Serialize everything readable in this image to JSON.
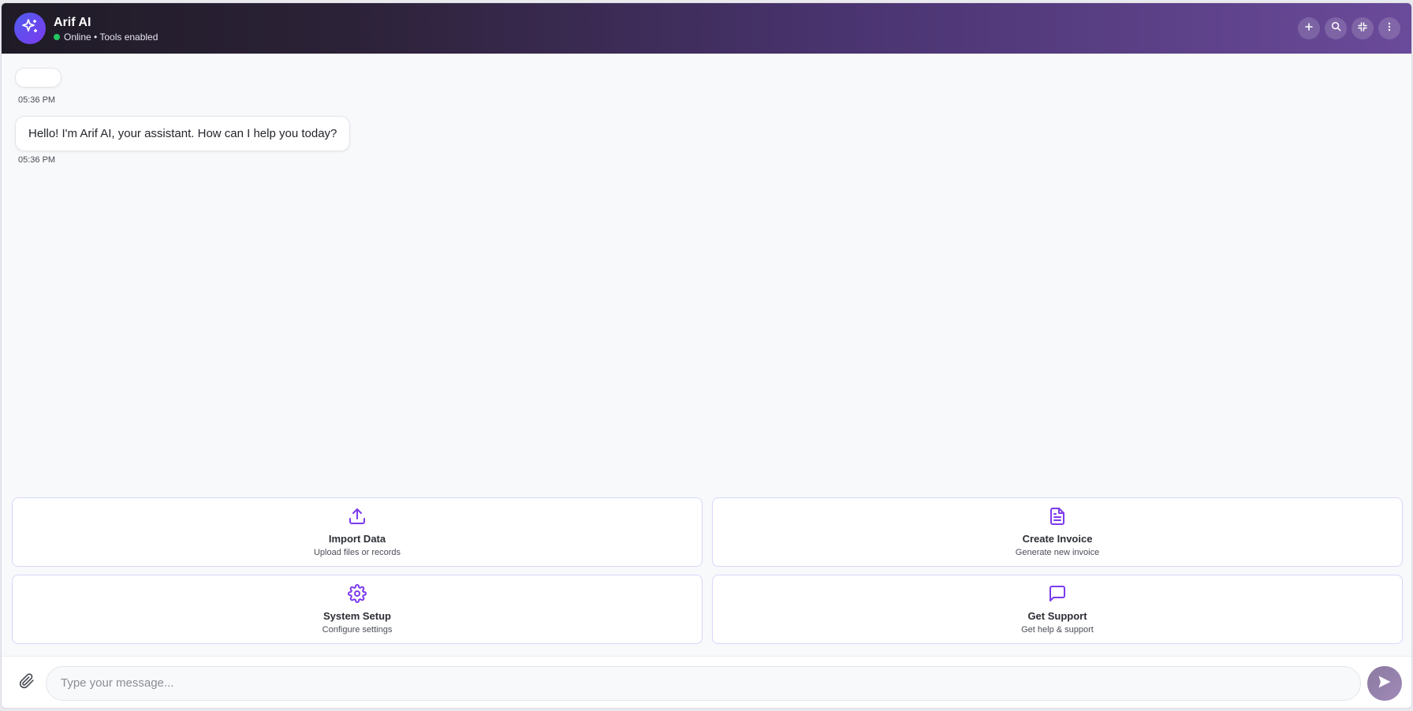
{
  "header": {
    "title": "Arif AI",
    "status": "Online • Tools enabled",
    "actions": [
      {
        "name": "new-chat",
        "icon": "plus-icon"
      },
      {
        "name": "search",
        "icon": "search-icon"
      },
      {
        "name": "minimize",
        "icon": "collapse-icon"
      },
      {
        "name": "menu",
        "icon": "more-vertical-icon"
      }
    ]
  },
  "messages": [
    {
      "text": "",
      "time": "05:36 PM"
    },
    {
      "text": "Hello! I'm Arif AI, your assistant. How can I help you today?",
      "time": "05:36 PM"
    }
  ],
  "quick_actions": [
    {
      "title": "Import Data",
      "subtitle": "Upload files or records",
      "icon": "upload-icon"
    },
    {
      "title": "Create Invoice",
      "subtitle": "Generate new invoice",
      "icon": "file-text-icon"
    },
    {
      "title": "System Setup",
      "subtitle": "Configure settings",
      "icon": "gear-icon"
    },
    {
      "title": "Get Support",
      "subtitle": "Get help & support",
      "icon": "message-square-icon"
    }
  ],
  "composer": {
    "placeholder": "Type your message..."
  },
  "colors": {
    "accent": "#7c3aed",
    "status_online": "#22c55e"
  }
}
